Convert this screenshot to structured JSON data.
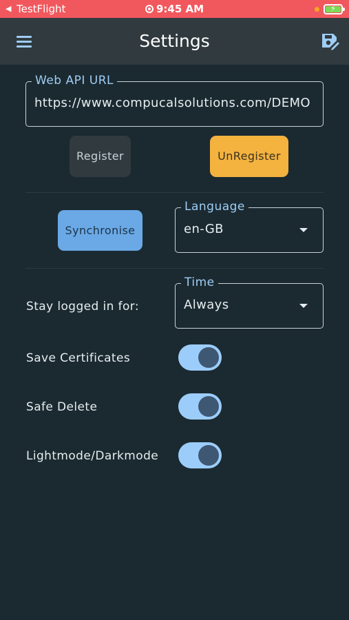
{
  "status_bar": {
    "back_glyph": "◀",
    "app": "TestFlight",
    "time": "9:45 AM"
  },
  "app_bar": {
    "title": "Settings",
    "menu_icon": "hamburger-menu-icon",
    "save_icon": "save-edit-icon"
  },
  "web_api": {
    "label": "Web API URL",
    "value": "https://www.compucalsolutions.com/DEMO"
  },
  "buttons": {
    "register": "Register",
    "unregister": "UnRegister",
    "synchronise": "Synchronise"
  },
  "language": {
    "label": "Language",
    "value": "en-GB"
  },
  "stay_logged_in": {
    "label": "Stay logged in for:",
    "field_label": "Time",
    "value": "Always"
  },
  "toggles": [
    {
      "label": "Save Certificates",
      "on": true
    },
    {
      "label": "Safe Delete",
      "on": true
    },
    {
      "label": "Lightmode/Darkmode",
      "on": true
    }
  ],
  "colors": {
    "background": "#1b2a31",
    "app_bar": "#303a3f",
    "status_bar": "#f1585d",
    "accent_blue": "#9fcdf4",
    "unregister": "#f4b23f",
    "synchronise": "#6aa9e6"
  }
}
